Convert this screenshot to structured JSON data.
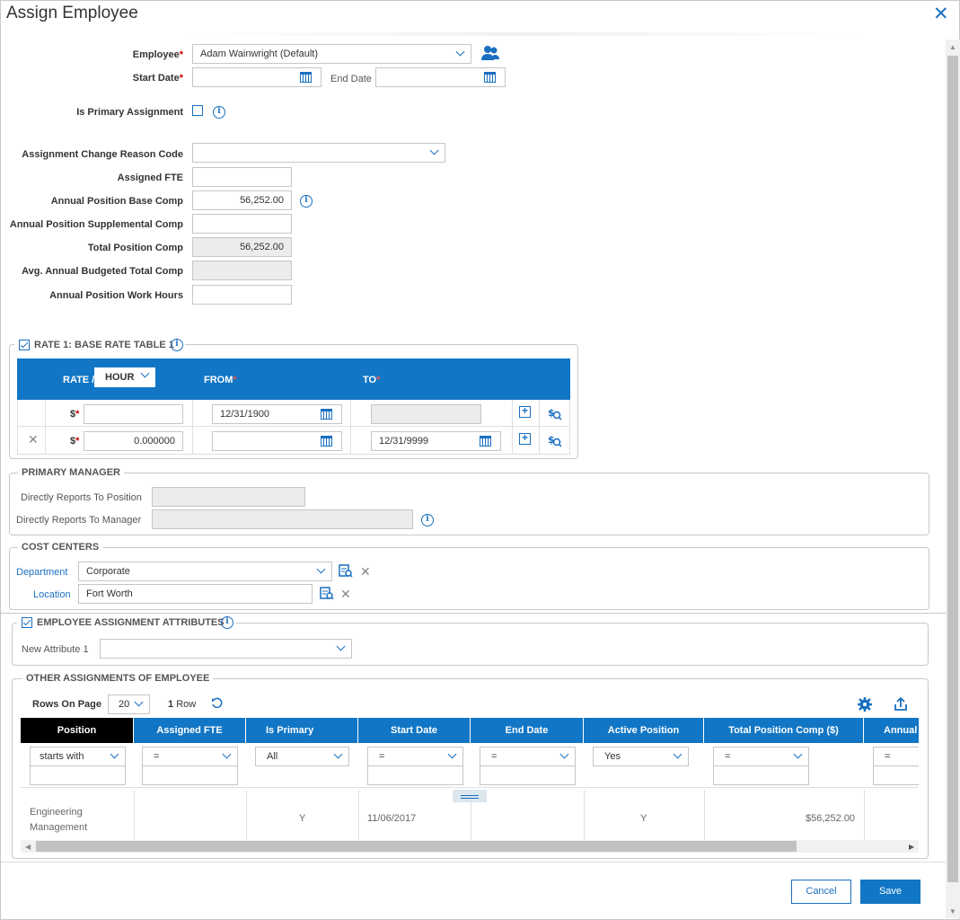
{
  "dialog": {
    "title": "Assign Employee",
    "close_glyph": "✕"
  },
  "form": {
    "employee_label": "Employee",
    "employee_value": "Adam Wainwright (Default)",
    "start_date_label": "Start Date",
    "end_date_label": "End Date",
    "primary_label": "Is Primary Assignment",
    "reason_label": "Assignment Change Reason Code",
    "fte_label": "Assigned FTE",
    "base_comp_label": "Annual Position Base Comp",
    "base_comp_value": "56,252.00",
    "supp_comp_label": "Annual Position Supplemental Comp",
    "total_comp_label": "Total Position Comp",
    "total_comp_value": "56,252.00",
    "avg_comp_label": "Avg. Annual Budgeted Total Comp",
    "work_hours_label": "Annual Position Work Hours",
    "required_mark": "*"
  },
  "rate": {
    "legend": "RATE 1: BASE RATE TABLE 1",
    "rate_label": "RATE /",
    "unit": "HOUR",
    "from_label": "FROM",
    "to_label": "TO",
    "currency": "$",
    "rows": [
      {
        "amount": "",
        "from": "12/31/1900",
        "to": ""
      },
      {
        "amount": "0.000000",
        "from": "",
        "to": "12/31/9999"
      }
    ]
  },
  "manager": {
    "legend": "PRIMARY MANAGER",
    "reports_position": "Directly Reports To Position",
    "reports_manager": "Directly Reports To Manager"
  },
  "cost": {
    "legend": "COST CENTERS",
    "department_label": "Department",
    "department_value": "Corporate",
    "location_label": "Location",
    "location_value": "Fort Worth"
  },
  "attrs": {
    "legend": "EMPLOYEE ASSIGNMENT ATTRIBUTES",
    "attr1_label": "New Attribute 1"
  },
  "other": {
    "legend": "OTHER ASSIGNMENTS OF EMPLOYEE",
    "rows_on_page_label": "Rows On Page",
    "rows_on_page": "20",
    "row_count": "1",
    "row_word": "Row",
    "columns": [
      "Position",
      "Assigned FTE",
      "Is Primary",
      "Start Date",
      "End Date",
      "Active Position",
      "Total Position Comp ($)",
      "Annual"
    ],
    "filters": [
      "starts with",
      "=",
      "All",
      "=",
      "=",
      "Yes",
      "=",
      "="
    ],
    "row": {
      "position": "Engineering Management",
      "primary": "Y",
      "start": "11/06/2017",
      "active": "Y",
      "total": "$56,252.00"
    }
  },
  "buttons": {
    "cancel": "Cancel",
    "save": "Save"
  },
  "colors": {
    "accent": "#1176c5",
    "required": "#cc0000"
  }
}
